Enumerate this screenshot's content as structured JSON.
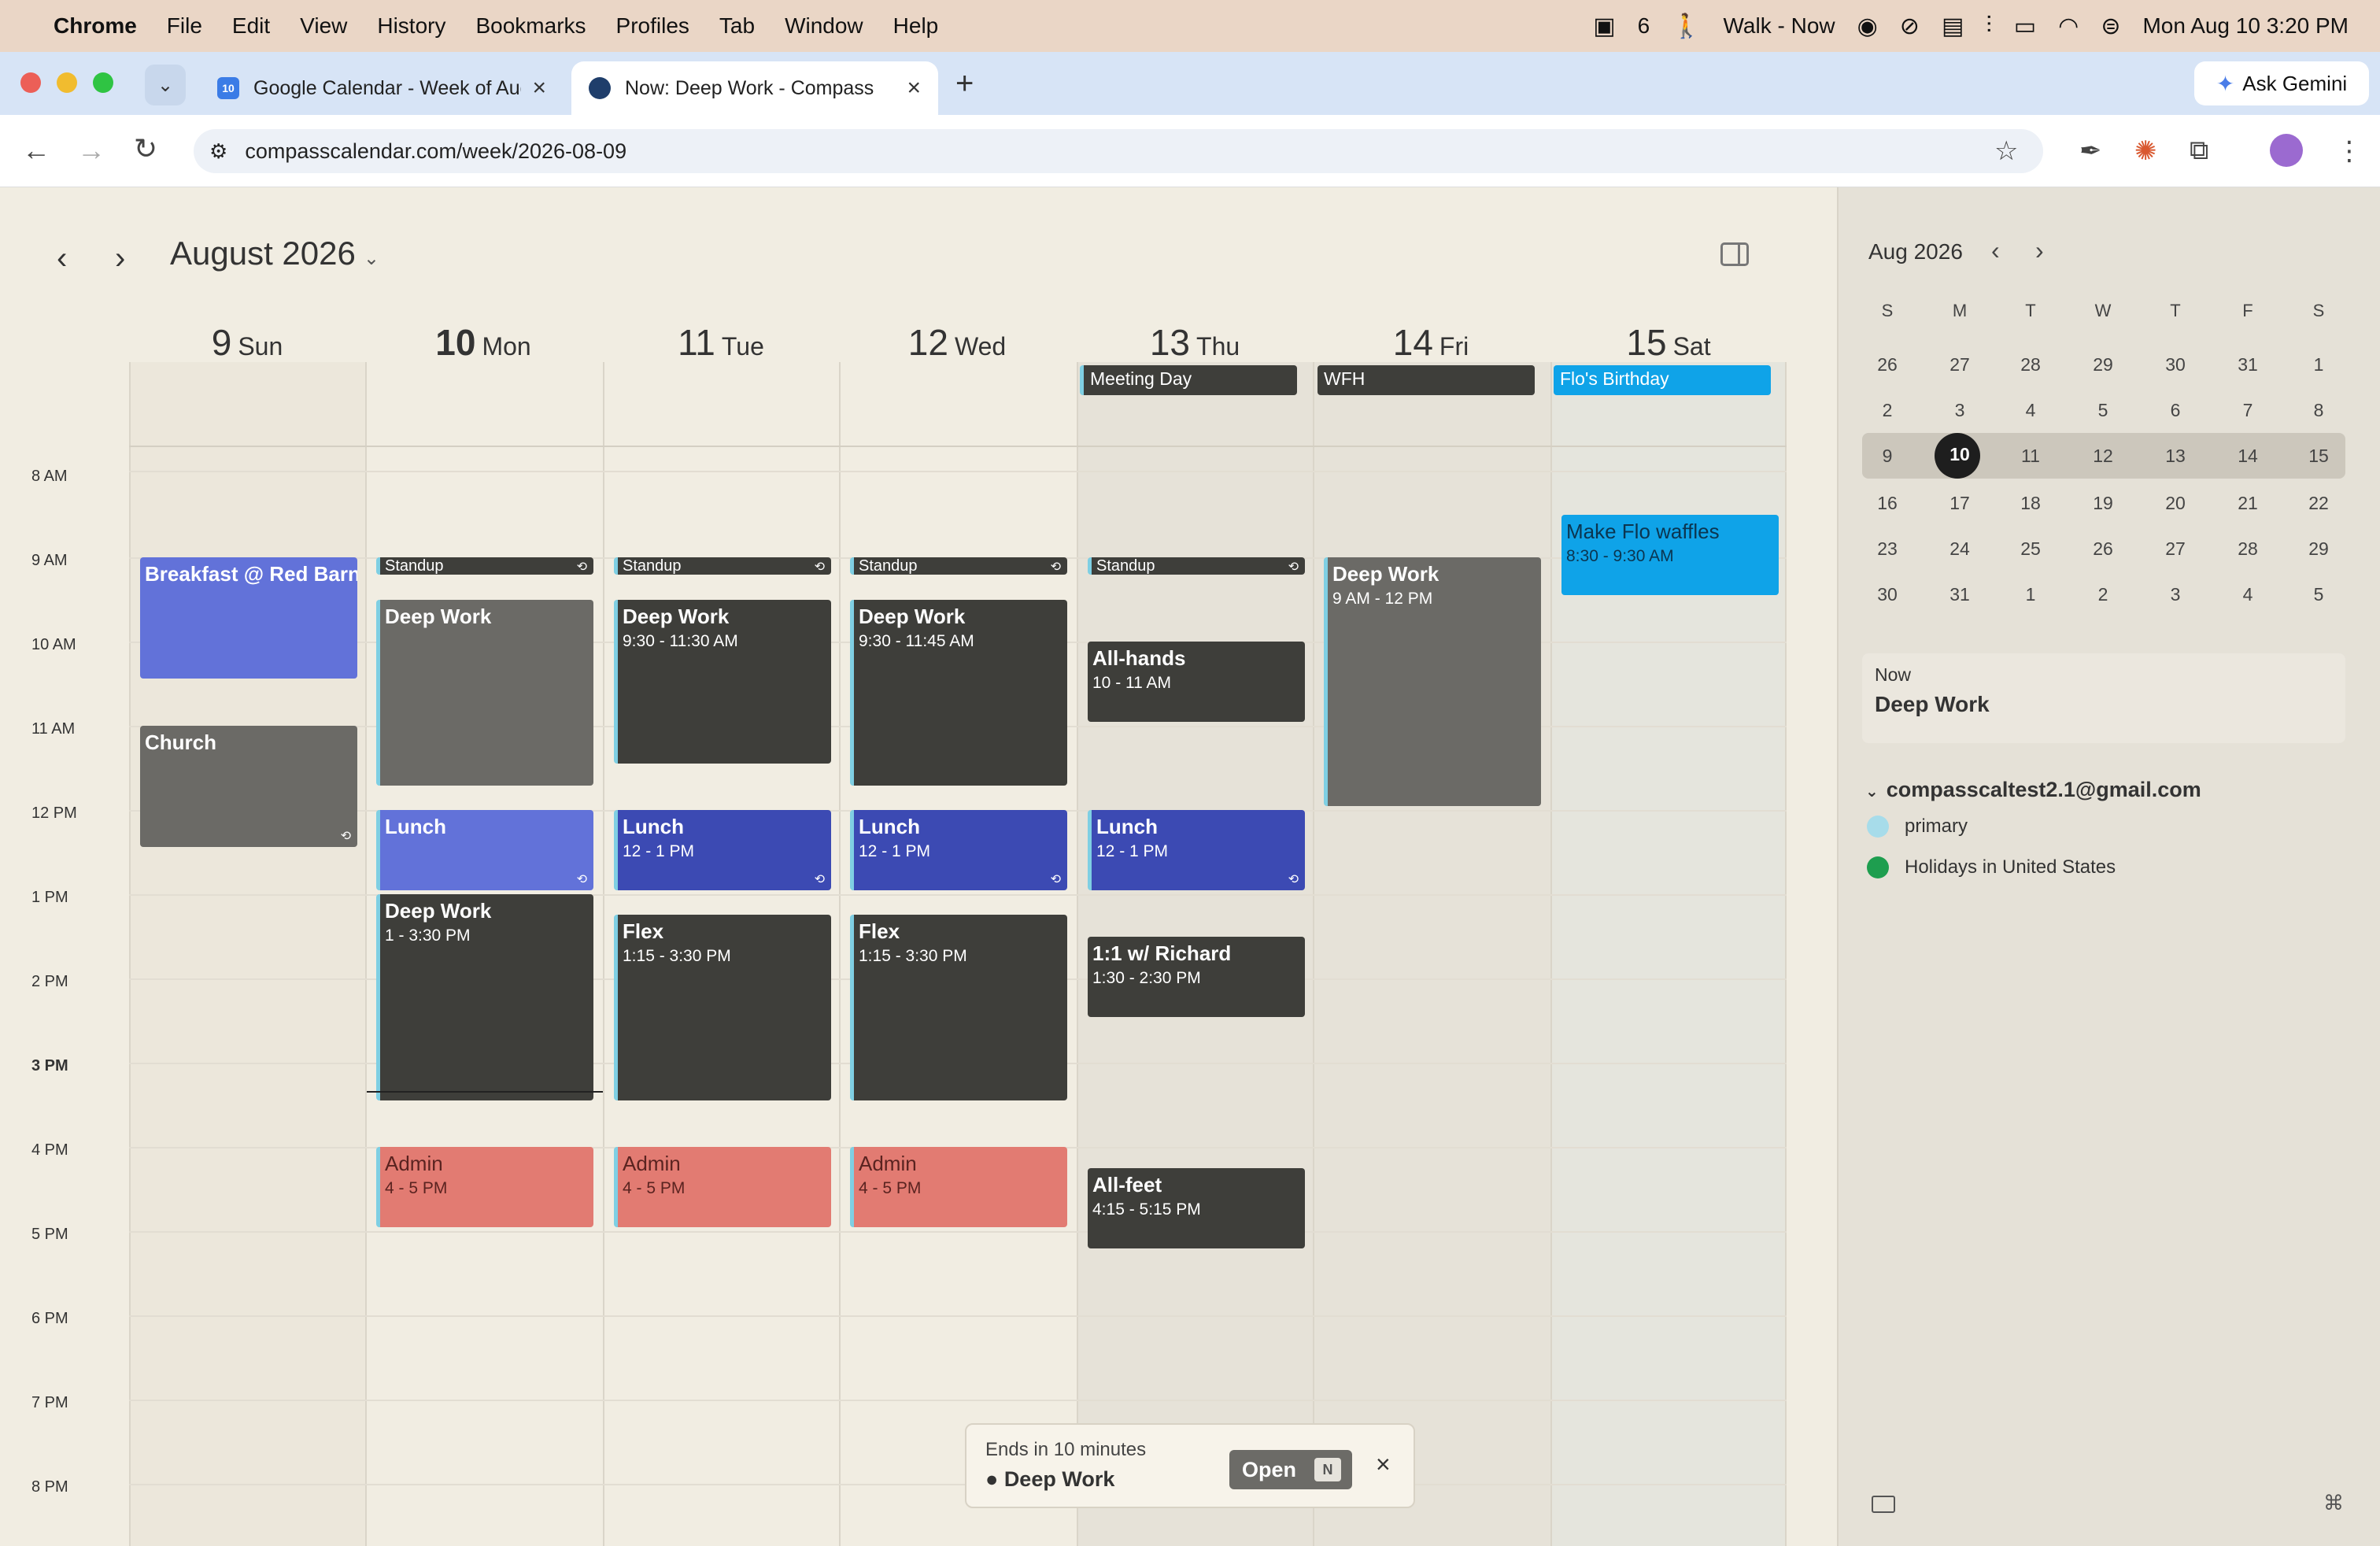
{
  "menubar": {
    "apple": "",
    "app": "Chrome",
    "items": [
      "File",
      "Edit",
      "View",
      "History",
      "Bookmarks",
      "Profiles",
      "Tab",
      "Window",
      "Help"
    ],
    "status_count": "6",
    "status_walk": "Walk - Now",
    "datetime": "Mon Aug 10  3:20 PM"
  },
  "tabs": [
    {
      "label": "Google Calendar - Week of Aug",
      "favicon": "10",
      "active": false
    },
    {
      "label": "Now: Deep Work - Compass",
      "favicon": "",
      "active": true
    }
  ],
  "tab_close": "×",
  "new_tab": "+",
  "ask_gemini": "Ask Gemini",
  "url": "compasscalendar.com/week/2026-08-09",
  "calendar": {
    "month_title": "August 2026",
    "days": [
      {
        "num": "9",
        "name": "Sun"
      },
      {
        "num": "10",
        "name": "Mon"
      },
      {
        "num": "11",
        "name": "Tue"
      },
      {
        "num": "12",
        "name": "Wed"
      },
      {
        "num": "13",
        "name": "Thu"
      },
      {
        "num": "14",
        "name": "Fri"
      },
      {
        "num": "15",
        "name": "Sat"
      }
    ],
    "hours": [
      "8 AM",
      "9 AM",
      "10 AM",
      "11 AM",
      "12 PM",
      "1 PM",
      "2 PM",
      "3 PM",
      "4 PM",
      "5 PM",
      "6 PM",
      "7 PM",
      "8 PM"
    ],
    "allday": [
      {
        "title": "Meeting Day",
        "color": "#3e3e3a"
      },
      {
        "title": "WFH",
        "color": "#3e3e3a"
      },
      {
        "title": "Flo's Birthday",
        "color": "#0fa3e8"
      }
    ],
    "events": {
      "breakfast": {
        "title": "Breakfast @ Red Barn",
        "time": ""
      },
      "church": {
        "title": "Church",
        "time": ""
      },
      "standup": {
        "title": "Standup"
      },
      "mon_deep1": {
        "title": "Deep Work",
        "time": ""
      },
      "mon_lunch": {
        "title": "Lunch",
        "time": ""
      },
      "mon_deep2": {
        "title": "Deep Work",
        "time": "1 - 3:30 PM"
      },
      "mon_admin": {
        "title": "Admin",
        "time": "4 - 5 PM"
      },
      "tue_deep": {
        "title": "Deep Work",
        "time": "9:30 - 11:30 AM"
      },
      "tue_lunch": {
        "title": "Lunch",
        "time": "12 - 1 PM"
      },
      "tue_flex": {
        "title": "Flex",
        "time": "1:15 - 3:30 PM"
      },
      "tue_admin": {
        "title": "Admin",
        "time": "4 - 5 PM"
      },
      "wed_deep": {
        "title": "Deep Work",
        "time": "9:30 - 11:45 AM"
      },
      "wed_lunch": {
        "title": "Lunch",
        "time": "12 - 1 PM"
      },
      "wed_flex": {
        "title": "Flex",
        "time": "1:15 - 3:30 PM"
      },
      "wed_admin": {
        "title": "Admin",
        "time": "4 - 5 PM"
      },
      "thu_allhands": {
        "title": "All-hands",
        "time": "10 - 11 AM"
      },
      "thu_lunch": {
        "title": "Lunch",
        "time": "12 - 1 PM"
      },
      "thu_richard": {
        "title": "1:1 w/ Richard",
        "time": "1:30 - 2:30 PM"
      },
      "thu_allfeet": {
        "title": "All-feet",
        "time": "4:15 - 5:15 PM"
      },
      "fri_deep": {
        "title": "Deep Work",
        "time": "9 AM - 12 PM"
      },
      "sat_waffles": {
        "title": "Make Flo waffles",
        "time": "8:30 - 9:30 AM"
      }
    },
    "colors": {
      "dark": "#3e3e3a",
      "gray": "#6b6a66",
      "blue_light": "#6272d9",
      "blue": "#3c4ab3",
      "salmon": "#e27b72",
      "cyan": "#0fa3e8"
    }
  },
  "sidebar": {
    "mini_title": "Aug 2026",
    "dow": [
      "S",
      "M",
      "T",
      "W",
      "T",
      "F",
      "S"
    ],
    "weeks": [
      [
        "26",
        "27",
        "28",
        "29",
        "30",
        "31",
        "1"
      ],
      [
        "2",
        "3",
        "4",
        "5",
        "6",
        "7",
        "8"
      ],
      [
        "9",
        "10",
        "11",
        "12",
        "13",
        "14",
        "15"
      ],
      [
        "16",
        "17",
        "18",
        "19",
        "20",
        "21",
        "22"
      ],
      [
        "23",
        "24",
        "25",
        "26",
        "27",
        "28",
        "29"
      ],
      [
        "30",
        "31",
        "1",
        "2",
        "3",
        "4",
        "5"
      ]
    ],
    "now_label": "Now",
    "now_event": "Deep Work",
    "account": "compasscaltest2.1@gmail.com",
    "calendars": [
      {
        "name": "primary",
        "color": "#a7dcea"
      },
      {
        "name": "Holidays in United States",
        "color": "#1e9e4f"
      }
    ]
  },
  "toast": {
    "ends": "Ends in 10 minutes",
    "event": "Deep Work",
    "open": "Open",
    "key": "N",
    "close": "×"
  }
}
